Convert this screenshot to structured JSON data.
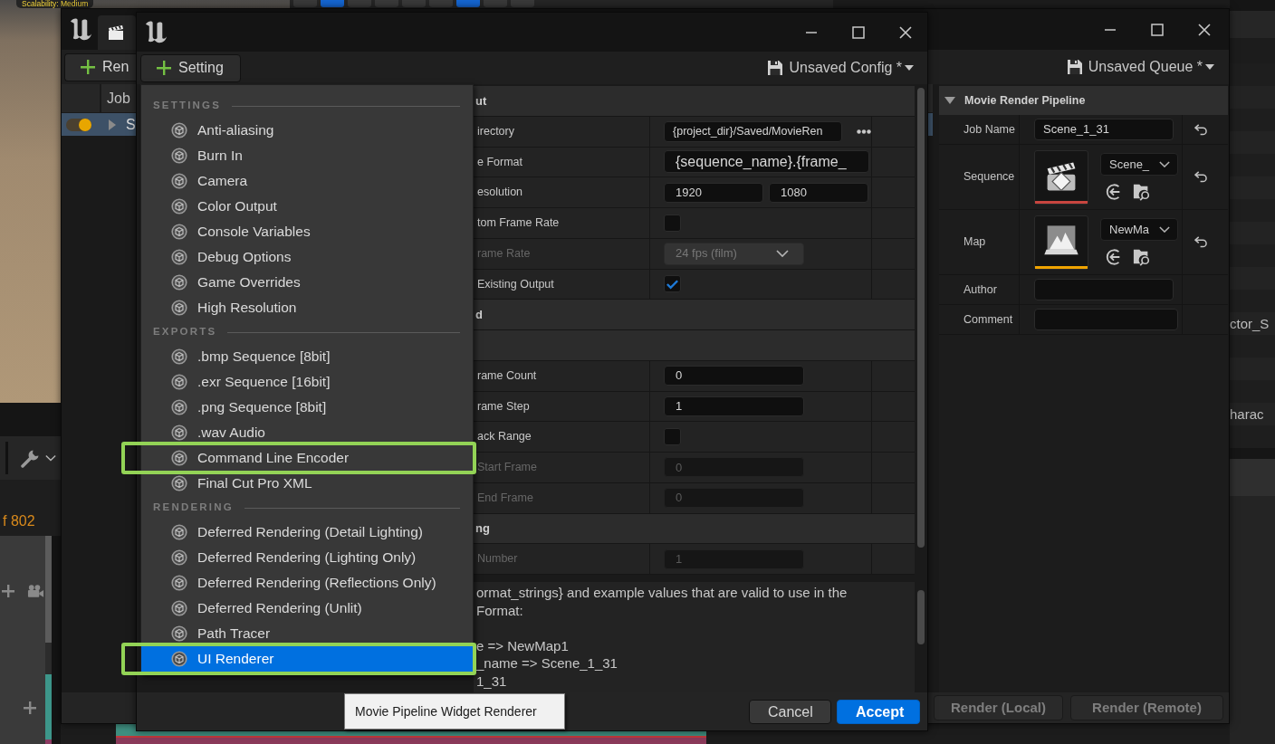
{
  "viewport": {
    "overlay_label": "Scalability: Medium",
    "toolbar": [
      {
        "on": false
      },
      {
        "on": true
      },
      {
        "on": false
      },
      {
        "on": false
      },
      {
        "on": false
      },
      {
        "on": false
      },
      {
        "on": true
      },
      {
        "on": false
      },
      {
        "on": false
      }
    ]
  },
  "timeline": {
    "frame_counter": "f 802"
  },
  "outliner": {
    "rows": [
      "ctor_S",
      "harac"
    ]
  },
  "queue_window": {
    "add_button": "Ren",
    "queue_menu": "Unsaved Queue *",
    "job_list": {
      "columns": [
        "Job"
      ],
      "rows": [
        {
          "name": "S",
          "enabled": true,
          "selected": true
        }
      ]
    },
    "details": {
      "section": "Movie Render Pipeline",
      "expanded": true,
      "rows": [
        {
          "kind": "text",
          "label": "Job Name",
          "value": "Scene_1_31",
          "resettable": true
        },
        {
          "kind": "sequence",
          "label": "Sequence",
          "value": "Scene_",
          "color": "#c8453f",
          "resettable": true
        },
        {
          "kind": "map",
          "label": "Map",
          "value": "NewMa",
          "color": "#f0a400",
          "resettable": true
        },
        {
          "kind": "text",
          "label": "Author",
          "resettable": false
        },
        {
          "kind": "text",
          "label": "Comment",
          "resettable": false
        }
      ]
    },
    "buttons": [
      {
        "label": "Render (Local)",
        "disabled": true
      },
      {
        "label": "Render (Remote)",
        "disabled": true
      }
    ]
  },
  "config_window": {
    "add_button": "Setting",
    "config_menu": "Unsaved Config *",
    "properties": [
      {
        "kind": "header",
        "label": "ut"
      },
      {
        "kind": "path",
        "label": "irectory",
        "value": "{project_dir}/Saved/MovieRen"
      },
      {
        "kind": "text",
        "label": "e Format",
        "value": "{sequence_name}.{frame_"
      },
      {
        "kind": "pair",
        "label": "esolution",
        "values": [
          "1920",
          "1080"
        ]
      },
      {
        "kind": "checkbox",
        "label": "tom Frame Rate",
        "checked": false
      },
      {
        "kind": "dropdown",
        "label": "rame Rate",
        "value": "24 fps (film)",
        "disabled": true
      },
      {
        "kind": "checkbox",
        "label": "Existing Output",
        "checked": true
      },
      {
        "kind": "header",
        "label": "d"
      },
      {
        "kind": "header"
      },
      {
        "kind": "number",
        "label": "rame Count",
        "value": "0",
        "disabled": false
      },
      {
        "kind": "number",
        "label": "rame Step",
        "value": "1",
        "disabled": false
      },
      {
        "kind": "checkbox",
        "label": "ack Range",
        "checked": false
      },
      {
        "kind": "number",
        "label": "Start Frame",
        "value": "0",
        "disabled": true
      },
      {
        "kind": "number",
        "label": "End Frame",
        "value": "0",
        "disabled": true
      },
      {
        "kind": "header",
        "label": "ng"
      },
      {
        "kind": "number",
        "label": "Number",
        "value": "1",
        "disabled": true
      }
    ],
    "description": [
      "ormat_strings} and example values that are valid to use in the\nFormat:",
      "e => NewMap1\n_name => Scene_1_31\n1_31"
    ],
    "buttons": [
      {
        "label": "Cancel",
        "primary": false
      },
      {
        "label": "Accept",
        "primary": true
      }
    ]
  },
  "settings_menu": {
    "sections": [
      {
        "title": "SETTINGS",
        "items": [
          {
            "label": "Anti-aliasing",
            "selected": false,
            "framed": false
          },
          {
            "label": "Burn In",
            "selected": false,
            "framed": false
          },
          {
            "label": "Camera",
            "selected": false,
            "framed": false
          },
          {
            "label": "Color Output",
            "selected": false,
            "framed": false
          },
          {
            "label": "Console Variables",
            "selected": false,
            "framed": false
          },
          {
            "label": "Debug Options",
            "selected": false,
            "framed": false
          },
          {
            "label": "Game Overrides",
            "selected": false,
            "framed": false
          },
          {
            "label": "High Resolution",
            "selected": false,
            "framed": false
          }
        ]
      },
      {
        "title": "EXPORTS",
        "items": [
          {
            "label": ".bmp Sequence [8bit]",
            "selected": false,
            "framed": false
          },
          {
            "label": ".exr Sequence [16bit]",
            "selected": false,
            "framed": false
          },
          {
            "label": ".png Sequence [8bit]",
            "selected": false,
            "framed": false
          },
          {
            "label": ".wav Audio",
            "selected": false,
            "framed": false
          },
          {
            "label": "Command Line Encoder",
            "selected": false,
            "framed": true
          },
          {
            "label": "Final Cut Pro XML",
            "selected": false,
            "framed": false
          }
        ]
      },
      {
        "title": "RENDERING",
        "items": [
          {
            "label": "Deferred Rendering (Detail Lighting)",
            "selected": false,
            "framed": false
          },
          {
            "label": "Deferred Rendering (Lighting Only)",
            "selected": false,
            "framed": false
          },
          {
            "label": "Deferred Rendering (Reflections Only)",
            "selected": false,
            "framed": false
          },
          {
            "label": "Deferred Rendering (Unlit)",
            "selected": false,
            "framed": false
          },
          {
            "label": "Path Tracer",
            "selected": false,
            "framed": false
          },
          {
            "label": "UI Renderer",
            "selected": true,
            "framed": true
          }
        ]
      }
    ],
    "tooltip": "Movie Pipeline Widget Renderer"
  }
}
